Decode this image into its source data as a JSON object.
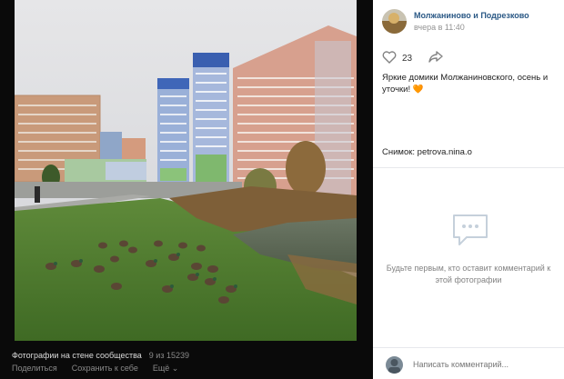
{
  "viewer": {
    "caption_title": "Фотографии на стене сообщества",
    "caption_count": "9 из 15239",
    "actions": {
      "share": "Поделиться",
      "save": "Сохранить к себе",
      "more": "Ещё ⌄"
    }
  },
  "post": {
    "author": "Молжаниново и Подрезково",
    "time": "вчера в 11:40",
    "likes": "23",
    "description": "Яркие домики Молжаниновского, осень и уточки! 🧡",
    "credit": "Снимок: petrova.nina.o"
  },
  "comments": {
    "empty_text": "Будьте первым, кто оставит комментарий к этой фотографии",
    "input_placeholder": "Написать комментарий..."
  },
  "colors": {
    "link": "#2a5885",
    "muted": "#828282",
    "viewer_bg": "#0a0a0a"
  },
  "icons": {
    "like": "heart-icon",
    "share": "share-arrow-icon",
    "empty": "comment-bubble-icon"
  }
}
